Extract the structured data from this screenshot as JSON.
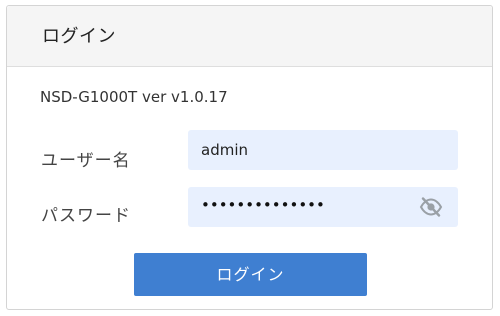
{
  "header": {
    "title": "ログイン"
  },
  "device": {
    "version_text": "NSD-G1000T ver v1.0.17"
  },
  "form": {
    "username_label": "ユーザー名",
    "username_value": "admin",
    "password_label": "パスワード",
    "password_mask": "••••••••••••••",
    "password_visibility_icon": "eye-slash-icon",
    "submit_label": "ログイン"
  },
  "colors": {
    "accent": "#3f7fd1",
    "input_background": "#e8f0fe",
    "header_background": "#f5f5f5"
  }
}
